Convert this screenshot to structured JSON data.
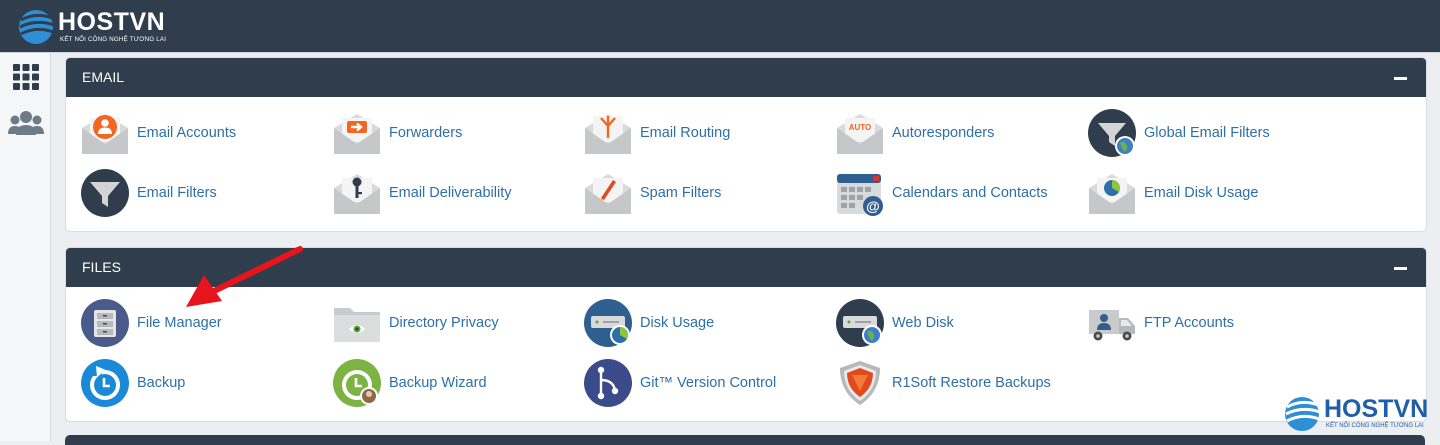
{
  "header": {
    "brand": "HOSTVN",
    "tagline": "KẾT NỐI CÔNG NGHỆ TƯƠNG LAI"
  },
  "sidebar": {
    "items": [
      {
        "icon": "grid-icon"
      },
      {
        "icon": "users-icon"
      }
    ]
  },
  "sections": {
    "email": {
      "title": "EMAIL",
      "items": [
        {
          "label": "Email Accounts",
          "icon": "email-accounts-icon"
        },
        {
          "label": "Forwarders",
          "icon": "forwarders-icon"
        },
        {
          "label": "Email Routing",
          "icon": "email-routing-icon"
        },
        {
          "label": "Autoresponders",
          "icon": "autoresponders-icon",
          "badge": "AUTO"
        },
        {
          "label": "Global Email Filters",
          "icon": "global-email-filters-icon"
        },
        {
          "label": "Email Filters",
          "icon": "email-filters-icon"
        },
        {
          "label": "Email Deliverability",
          "icon": "email-deliverability-icon"
        },
        {
          "label": "Spam Filters",
          "icon": "spam-filters-icon"
        },
        {
          "label": "Calendars and Contacts",
          "icon": "calendars-contacts-icon"
        },
        {
          "label": "Email Disk Usage",
          "icon": "email-disk-usage-icon"
        }
      ]
    },
    "files": {
      "title": "FILES",
      "items": [
        {
          "label": "File Manager",
          "icon": "file-manager-icon"
        },
        {
          "label": "Directory Privacy",
          "icon": "directory-privacy-icon"
        },
        {
          "label": "Disk Usage",
          "icon": "disk-usage-icon"
        },
        {
          "label": "Web Disk",
          "icon": "web-disk-icon"
        },
        {
          "label": "FTP Accounts",
          "icon": "ftp-accounts-icon"
        },
        {
          "label": "Backup",
          "icon": "backup-icon"
        },
        {
          "label": "Backup Wizard",
          "icon": "backup-wizard-icon"
        },
        {
          "label": "Git™ Version Control",
          "icon": "git-icon"
        },
        {
          "label": "R1Soft Restore Backups",
          "icon": "r1soft-icon"
        }
      ]
    }
  },
  "watermark": {
    "brand": "HOSTVN",
    "tagline": "KẾT NỐI CÔNG NGHỆ TƯƠNG LAI"
  },
  "colors": {
    "header_bg": "#2f3d4d",
    "link": "#2f6fa8",
    "accent_orange": "#f26522",
    "arrow_red": "#e8141b"
  }
}
